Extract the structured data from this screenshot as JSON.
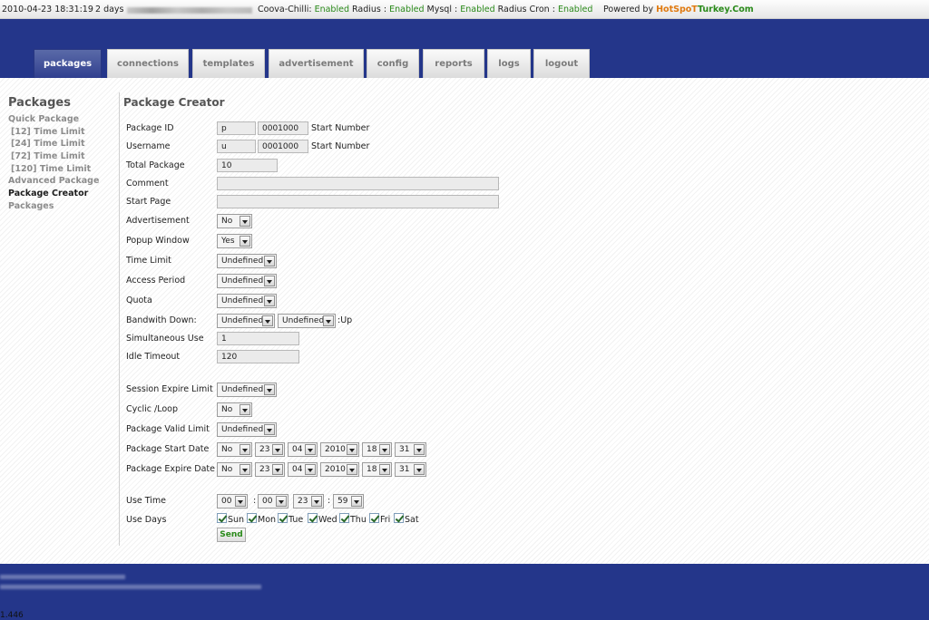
{
  "topbar": {
    "datetime": "2010-04-23 18:31:19",
    "uptime": "2 days",
    "status": [
      {
        "label": "Coova-Chilli:",
        "value": "Enabled"
      },
      {
        "label": "Radius :",
        "value": "Enabled"
      },
      {
        "label": "Mysql :",
        "value": "Enabled"
      },
      {
        "label": "Radius Cron :",
        "value": "Enabled"
      }
    ],
    "powered_by": "Powered by",
    "brand_a": "HotSpoT",
    "brand_b": "Turkey.Com"
  },
  "nav": {
    "tabs": [
      "packages",
      "connections",
      "templates",
      "advertisement",
      "config",
      "reports",
      "logs",
      "logout"
    ],
    "active": "packages"
  },
  "sidebar": {
    "title": "Packages",
    "items": [
      "Quick Package",
      "[12] Time Limit",
      "[24] Time Limit",
      "[72] Time Limit",
      "[120] Time Limit",
      "Advanced Package",
      "Package Creator",
      "Packages"
    ]
  },
  "form": {
    "title": "Package Creator",
    "package_id": {
      "label": "Package ID",
      "prefix": "p",
      "number": "0001000",
      "suffix": "Start Number"
    },
    "username": {
      "label": "Username",
      "prefix": "u",
      "number": "0001000",
      "suffix": "Start Number"
    },
    "total_package": {
      "label": "Total Package",
      "value": "10"
    },
    "comment": {
      "label": "Comment",
      "value": ""
    },
    "start_page": {
      "label": "Start Page",
      "value": ""
    },
    "advertisement": {
      "label": "Advertisement",
      "value": "No"
    },
    "popup_window": {
      "label": "Popup Window",
      "value": "Yes"
    },
    "time_limit": {
      "label": "Time Limit",
      "value": "Undefined"
    },
    "access_period": {
      "label": "Access Period",
      "value": "Undefined"
    },
    "quota": {
      "label": "Quota",
      "value": "Undefined"
    },
    "bandwidth": {
      "label": "Bandwith Down:",
      "down": "Undefined",
      "up": "Undefined",
      "suffix": ":Up"
    },
    "simultaneous_use": {
      "label": "Simultaneous Use",
      "value": "1"
    },
    "idle_timeout": {
      "label": "Idle Timeout",
      "value": "120"
    },
    "session_expire_limit": {
      "label": "Session Expire Limit",
      "value": "Undefined"
    },
    "cyclic_loop": {
      "label": "Cyclic /Loop",
      "value": "No"
    },
    "package_valid_limit": {
      "label": "Package Valid Limit",
      "value": "Undefined"
    },
    "package_start_date": {
      "label": "Package Start Date",
      "enabled": "No",
      "day": "23",
      "month": "04",
      "year": "2010",
      "hour": "18",
      "minute": "31"
    },
    "package_expire_date": {
      "label": "Package Expire Date",
      "enabled": "No",
      "day": "23",
      "month": "04",
      "year": "2010",
      "hour": "18",
      "minute": "31"
    },
    "use_time": {
      "label": "Use Time",
      "from_h": "00",
      "from_m": "00",
      "to_h": "23",
      "to_m": "59",
      "sep": ":"
    },
    "use_days": {
      "label": "Use Days",
      "days": [
        "Sun",
        "Mon",
        "Tue",
        "Wed",
        "Thu",
        "Fri",
        "Sat"
      ]
    },
    "send_label": "Send"
  },
  "footer": {
    "version": "1.446"
  }
}
